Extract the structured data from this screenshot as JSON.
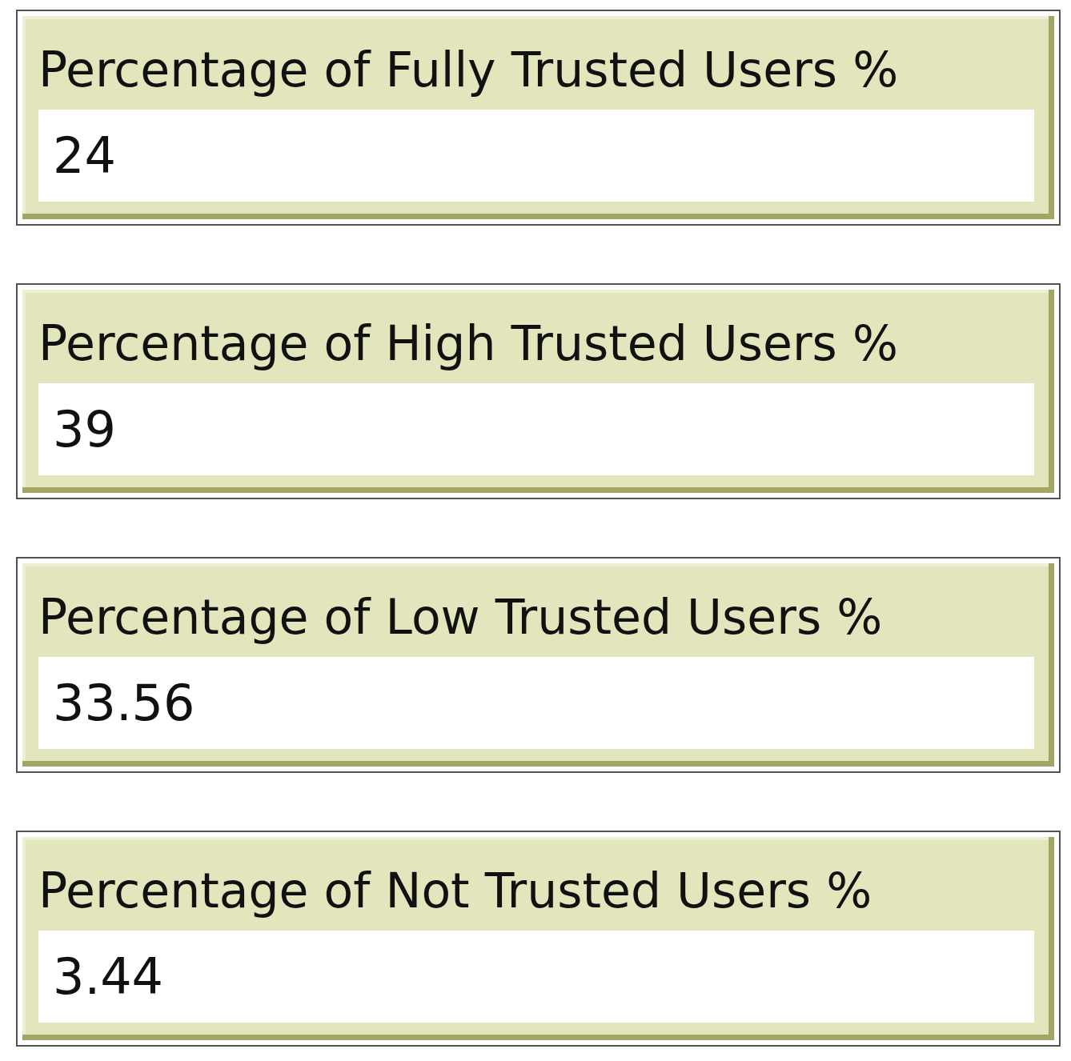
{
  "fields": [
    {
      "label": "Percentage of Fully Trusted Users %",
      "value": "24"
    },
    {
      "label": "Percentage of High Trusted Users %",
      "value": "39"
    },
    {
      "label": "Percentage of Low Trusted Users %",
      "value": "33.56"
    },
    {
      "label": "Percentage of Not Trusted Users %",
      "value": "3.44"
    }
  ]
}
